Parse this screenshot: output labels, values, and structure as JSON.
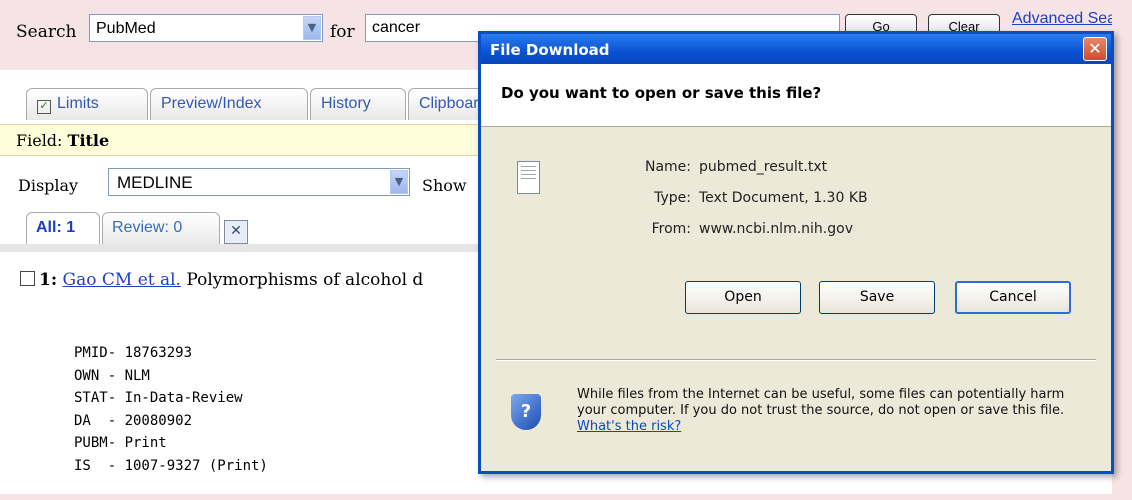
{
  "search": {
    "label": "Search",
    "database": "PubMed",
    "for_label": "for",
    "query": "cancer",
    "go_label": "Go",
    "clear_label": "Clear",
    "advanced_label": "Advanced Search"
  },
  "tabs": [
    {
      "label": "Limits"
    },
    {
      "label": "Preview/Index"
    },
    {
      "label": "History"
    },
    {
      "label": "Clipboard"
    }
  ],
  "field": {
    "label": "Field:",
    "value": "Title"
  },
  "display": {
    "label": "Display",
    "value": "MEDLINE",
    "show_label": "Show"
  },
  "subtabs": {
    "all": "All: 1",
    "review": "Review: 0"
  },
  "result": {
    "number": "1:",
    "authors": "Gao CM et al.",
    "title_snippet": "Polymorphisms of alcohol d"
  },
  "medline": [
    "PMID- 18763293",
    "OWN - NLM",
    "STAT- In-Data-Review",
    "DA  - 20080902",
    "PUBM- Print",
    "IS  - 1007-9327 (Print)"
  ],
  "dialog": {
    "title": "File Download",
    "question": "Do you want to open or save this file?",
    "name_label": "Name:",
    "name": "pubmed_result.txt",
    "type_label": "Type:",
    "type": "Text Document, 1.30 KB",
    "from_label": "From:",
    "from": "www.ncbi.nlm.nih.gov",
    "open_label": "Open",
    "save_label": "Save",
    "cancel_label": "Cancel",
    "warning": "While files from the Internet can be useful, some files can potentially harm your computer. If you do not trust the source, do not open or save this file.",
    "risk_link": "What's the risk?"
  },
  "colors": {
    "link": "#1d40c6",
    "title_bar": "#0a52d3",
    "dialog_bg": "#ece9d8"
  }
}
